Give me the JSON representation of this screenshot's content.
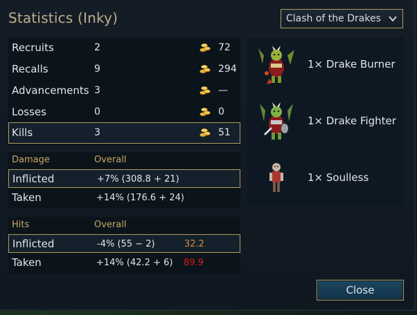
{
  "dialog": {
    "title": "Statistics (Inky)",
    "scenario_select": {
      "selected": "Clash of the Drakes",
      "icon": "chevron-down-icon"
    },
    "close_label": "Close"
  },
  "stats": {
    "rows": [
      {
        "label": "Recruits",
        "value": "2",
        "gold": "72"
      },
      {
        "label": "Recalls",
        "value": "9",
        "gold": "294"
      },
      {
        "label": "Advancements",
        "value": "3",
        "gold": "—"
      },
      {
        "label": "Losses",
        "value": "0",
        "gold": "0"
      },
      {
        "label": "Kills",
        "value": "3",
        "gold": "51"
      }
    ],
    "gold_icon": "gold-coins-icon"
  },
  "damage": {
    "header": "Damage",
    "overall_header": "Overall",
    "inflicted_label": "Inflicted",
    "inflicted_value": "+7% (308.8 + 21)",
    "taken_label": "Taken",
    "taken_value": "+14% (176.6 + 24)"
  },
  "hits": {
    "header": "Hits",
    "overall_header": "Overall",
    "inflicted_label": "Inflicted",
    "inflicted_value": "-4% (55 − 2)",
    "inflicted_extra": "32.2",
    "inflicted_extra_color": "#d4883a",
    "taken_label": "Taken",
    "taken_value": "+14% (42.2 + 6)",
    "taken_extra": "89.9",
    "taken_extra_color": "#d21e1e"
  },
  "units": [
    {
      "label": "1× Drake Burner",
      "icon": "drake-burner-sprite"
    },
    {
      "label": "1× Drake Fighter",
      "icon": "drake-fighter-sprite"
    },
    {
      "label": "1× Soulless",
      "icon": "soulless-sprite"
    }
  ],
  "colors": {
    "accent_gold": "#b39d5d",
    "title": "#bfae8a",
    "sub_header": "#c9a962"
  }
}
